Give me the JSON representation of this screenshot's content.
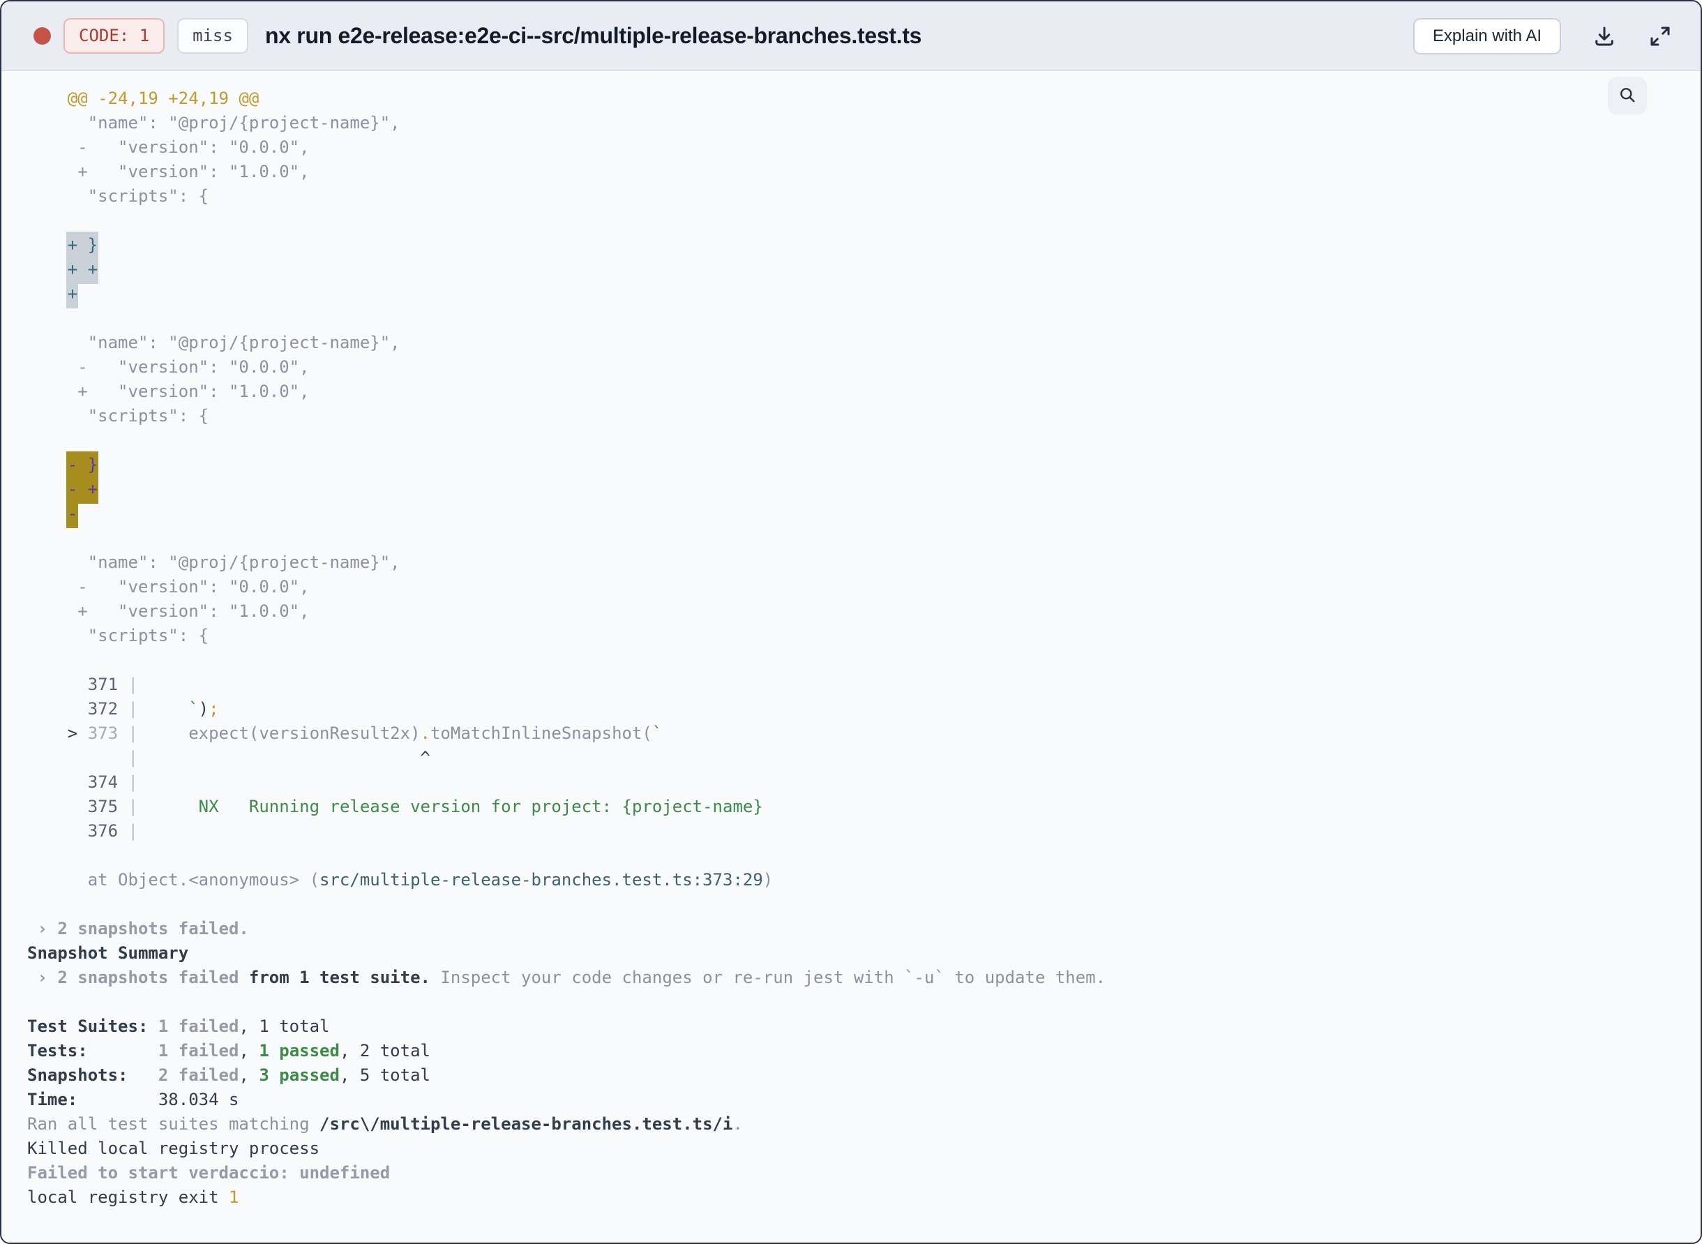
{
  "header": {
    "code_badge": "CODE: 1",
    "miss_badge": "miss",
    "title": "nx run e2e-release:e2e-ci--src/multiple-release-branches.test.ts",
    "explain_button": "Explain with AI",
    "icons": [
      "status-dot",
      "download-icon",
      "expand-icon"
    ]
  },
  "colors": {
    "status_red": "#c4534a",
    "badge_red_text": "#a93a31",
    "gold": "#bf9b2e",
    "green": "#3e8a48",
    "teal": "#3e6070",
    "highlight_gray_bg": "#cbd1d8",
    "highlight_gray_text": "#35697b",
    "highlight_gold_bg": "#a68d1d",
    "highlight_gold_text": "#5b3aa0"
  },
  "terminal": {
    "search_icon": "magnifier-icon",
    "lines": [
      [
        {
          "c": "gold",
          "t": "    @@ -24,19 +24,19 @@"
        }
      ],
      [
        {
          "c": "gray",
          "t": "      \"name\": \"@proj/{project-name}\","
        }
      ],
      [
        {
          "c": "gray",
          "t": "     -   \"version\": \"0.0.0\","
        }
      ],
      [
        {
          "c": "gray",
          "t": "     +   \"version\": \"1.0.0\","
        }
      ],
      [
        {
          "c": "gray",
          "t": "      \"scripts\": {"
        }
      ],
      [],
      [
        {
          "c": "plain",
          "t": "    "
        },
        {
          "c": "hl1",
          "t": "+ }"
        }
      ],
      [
        {
          "c": "plain",
          "t": "    "
        },
        {
          "c": "hl1",
          "t": "+ +"
        }
      ],
      [
        {
          "c": "plain",
          "t": "    "
        },
        {
          "c": "hl1",
          "t": "+"
        }
      ],
      [],
      [
        {
          "c": "gray",
          "t": "      \"name\": \"@proj/{project-name}\","
        }
      ],
      [
        {
          "c": "gray",
          "t": "     -   \"version\": \"0.0.0\","
        }
      ],
      [
        {
          "c": "gray",
          "t": "     +   \"version\": \"1.0.0\","
        }
      ],
      [
        {
          "c": "gray",
          "t": "      \"scripts\": {"
        }
      ],
      [],
      [
        {
          "c": "plain",
          "t": "    "
        },
        {
          "c": "hl2",
          "t": "- }"
        }
      ],
      [
        {
          "c": "plain",
          "t": "    "
        },
        {
          "c": "hl2",
          "t": "- +"
        }
      ],
      [
        {
          "c": "plain",
          "t": "    "
        },
        {
          "c": "hl2",
          "t": "-"
        }
      ],
      [],
      [
        {
          "c": "gray",
          "t": "      \"name\": \"@proj/{project-name}\","
        }
      ],
      [
        {
          "c": "gray",
          "t": "     -   \"version\": \"0.0.0\","
        }
      ],
      [
        {
          "c": "gray",
          "t": "     +   \"version\": \"1.0.0\","
        }
      ],
      [
        {
          "c": "gray",
          "t": "      \"scripts\": {"
        }
      ],
      [],
      [
        {
          "c": "num",
          "t": "      371"
        },
        {
          "c": "pipe",
          "t": " |"
        }
      ],
      [
        {
          "c": "num",
          "t": "      372"
        },
        {
          "c": "pipe",
          "t": " |"
        },
        {
          "c": "plain",
          "t": "     "
        },
        {
          "c": "green",
          "t": "`"
        },
        {
          "c": "dark",
          "t": ")"
        },
        {
          "c": "gold",
          "t": ";"
        }
      ],
      [
        {
          "c": "dark",
          "t": "    >"
        },
        {
          "c": "numl",
          "t": " 373"
        },
        {
          "c": "pipe",
          "t": " |"
        },
        {
          "c": "gray",
          "t": "     expect(versionResult2x)"
        },
        {
          "c": "gold",
          "t": "."
        },
        {
          "c": "gray",
          "t": "toMatchInlineSnapshot("
        },
        {
          "c": "green",
          "t": "`"
        }
      ],
      [
        {
          "c": "pipe",
          "t": "          |"
        },
        {
          "c": "caret",
          "t": "                            ^"
        }
      ],
      [
        {
          "c": "num",
          "t": "      374"
        },
        {
          "c": "pipe",
          "t": " |"
        }
      ],
      [
        {
          "c": "num",
          "t": "      375"
        },
        {
          "c": "pipe",
          "t": " |"
        },
        {
          "c": "green",
          "t": "      NX   Running release version for project: {project-name}"
        }
      ],
      [
        {
          "c": "num",
          "t": "      376"
        },
        {
          "c": "pipe",
          "t": " |"
        }
      ],
      [],
      [
        {
          "c": "gray",
          "t": "      at Object.<anonymous> ("
        },
        {
          "c": "teal",
          "t": "src/multiple-release-branches.test.ts:373:29"
        },
        {
          "c": "gray",
          "t": ")"
        }
      ],
      [],
      [
        {
          "c": "grayb",
          "t": " › 2 snapshots failed."
        }
      ],
      [
        {
          "c": "darkb",
          "t": "Snapshot Summary"
        }
      ],
      [
        {
          "c": "grayb",
          "t": " › 2 snapshots failed "
        },
        {
          "c": "darkb",
          "t": "from 1 test suite."
        },
        {
          "c": "gray",
          "t": " Inspect your code changes or re-run jest with `-u` to update them."
        }
      ],
      [],
      [
        {
          "c": "darkb",
          "t": "Test Suites: "
        },
        {
          "c": "grayb",
          "t": "1 failed"
        },
        {
          "c": "dark",
          "t": ", 1 total"
        }
      ],
      [
        {
          "c": "darkb",
          "t": "Tests:       "
        },
        {
          "c": "grayb",
          "t": "1 failed"
        },
        {
          "c": "dark",
          "t": ", "
        },
        {
          "c": "greenb",
          "t": "1 passed"
        },
        {
          "c": "dark",
          "t": ", 2 total"
        }
      ],
      [
        {
          "c": "darkb",
          "t": "Snapshots:   "
        },
        {
          "c": "grayb",
          "t": "2 failed"
        },
        {
          "c": "dark",
          "t": ", "
        },
        {
          "c": "greenb",
          "t": "3 passed"
        },
        {
          "c": "dark",
          "t": ", 5 total"
        }
      ],
      [
        {
          "c": "darkb",
          "t": "Time:        "
        },
        {
          "c": "dark",
          "t": "38.034 s"
        }
      ],
      [
        {
          "c": "gray",
          "t": "Ran all test suites matching "
        },
        {
          "c": "darkb",
          "t": "/src\\/multiple-release-branches.test.ts/i"
        },
        {
          "c": "gray",
          "t": "."
        }
      ],
      [
        {
          "c": "dark",
          "t": "Killed local registry process"
        }
      ],
      [
        {
          "c": "grayb",
          "t": "Failed to start verdaccio: undefined"
        }
      ],
      [
        {
          "c": "dark",
          "t": "local registry exit "
        },
        {
          "c": "gold",
          "t": "1"
        }
      ]
    ]
  }
}
